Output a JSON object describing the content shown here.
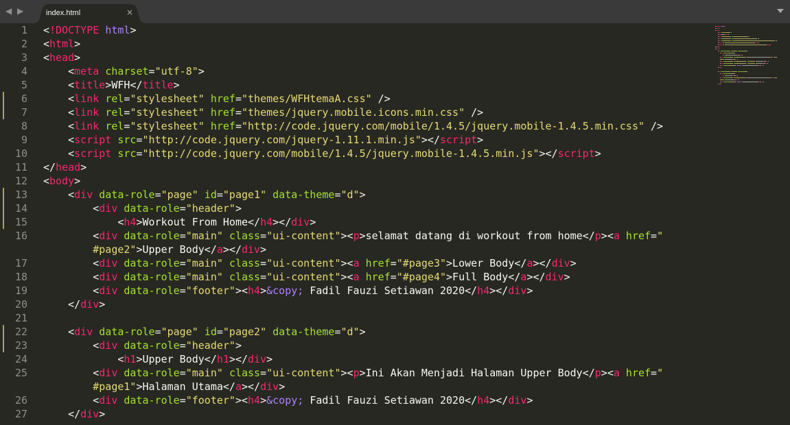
{
  "tab": {
    "title": "index.html",
    "close_label": "×"
  },
  "nav": {
    "arrows": "◀ ▶"
  },
  "lines": [
    {
      "n": "1",
      "parts": [
        [
          "p",
          "<"
        ],
        [
          "t",
          "!DOCTYPE"
        ],
        [
          "p",
          " "
        ],
        [
          "e",
          "html"
        ],
        [
          "p",
          ">"
        ]
      ]
    },
    {
      "n": "2",
      "parts": [
        [
          "p",
          "<"
        ],
        [
          "t",
          "html"
        ],
        [
          "p",
          ">"
        ]
      ]
    },
    {
      "n": "3",
      "parts": [
        [
          "p",
          "<"
        ],
        [
          "t",
          "head"
        ],
        [
          "p",
          ">"
        ]
      ]
    },
    {
      "n": "4",
      "parts": [
        [
          "p",
          "    <"
        ],
        [
          "t",
          "meta"
        ],
        [
          "p",
          " "
        ],
        [
          "a",
          "charset"
        ],
        [
          "p",
          "="
        ],
        [
          "s",
          "\"utf-8\""
        ],
        [
          "p",
          ">"
        ]
      ]
    },
    {
      "n": "5",
      "parts": [
        [
          "p",
          "    <"
        ],
        [
          "t",
          "title"
        ],
        [
          "p",
          ">WFH</"
        ],
        [
          "t",
          "title"
        ],
        [
          "p",
          ">"
        ]
      ]
    },
    {
      "n": "6",
      "parts": [
        [
          "p",
          "    <"
        ],
        [
          "t",
          "link"
        ],
        [
          "p",
          " "
        ],
        [
          "a",
          "rel"
        ],
        [
          "p",
          "="
        ],
        [
          "s",
          "\"stylesheet\""
        ],
        [
          "p",
          " "
        ],
        [
          "a",
          "href"
        ],
        [
          "p",
          "="
        ],
        [
          "s",
          "\"themes/WFHtemaA.css\""
        ],
        [
          "p",
          " />"
        ]
      ]
    },
    {
      "n": "7",
      "parts": [
        [
          "p",
          "    <"
        ],
        [
          "t",
          "link"
        ],
        [
          "p",
          " "
        ],
        [
          "a",
          "rel"
        ],
        [
          "p",
          "="
        ],
        [
          "s",
          "\"stylesheet\""
        ],
        [
          "p",
          " "
        ],
        [
          "a",
          "href"
        ],
        [
          "p",
          "="
        ],
        [
          "s",
          "\"themes/jquery.mobile.icons.min.css\""
        ],
        [
          "p",
          " />"
        ]
      ]
    },
    {
      "n": "8",
      "parts": [
        [
          "p",
          "    <"
        ],
        [
          "t",
          "link"
        ],
        [
          "p",
          " "
        ],
        [
          "a",
          "rel"
        ],
        [
          "p",
          "="
        ],
        [
          "s",
          "\"stylesheet\""
        ],
        [
          "p",
          " "
        ],
        [
          "a",
          "href"
        ],
        [
          "p",
          "="
        ],
        [
          "s",
          "\"http://code.jquery.com/mobile/1.4.5/jquery.mobile-1.4.5.min.css\""
        ],
        [
          "p",
          " />"
        ]
      ]
    },
    {
      "n": "9",
      "parts": [
        [
          "p",
          "    <"
        ],
        [
          "t",
          "script"
        ],
        [
          "p",
          " "
        ],
        [
          "a",
          "src"
        ],
        [
          "p",
          "="
        ],
        [
          "s",
          "\"http://code.jquery.com/jquery-1.11.1.min.js\""
        ],
        [
          "p",
          "></"
        ],
        [
          "t",
          "script"
        ],
        [
          "p",
          ">"
        ]
      ]
    },
    {
      "n": "10",
      "parts": [
        [
          "p",
          "    <"
        ],
        [
          "t",
          "script"
        ],
        [
          "p",
          " "
        ],
        [
          "a",
          "src"
        ],
        [
          "p",
          "="
        ],
        [
          "s",
          "\"http://code.jquery.com/mobile/1.4.5/jquery.mobile-1.4.5.min.js\""
        ],
        [
          "p",
          "></"
        ],
        [
          "t",
          "script"
        ],
        [
          "p",
          ">"
        ]
      ]
    },
    {
      "n": "11",
      "parts": [
        [
          "p",
          "</"
        ],
        [
          "t",
          "head"
        ],
        [
          "p",
          ">"
        ]
      ]
    },
    {
      "n": "12",
      "parts": [
        [
          "p",
          "<"
        ],
        [
          "t",
          "body"
        ],
        [
          "p",
          ">"
        ]
      ]
    },
    {
      "n": "13",
      "parts": [
        [
          "p",
          "    <"
        ],
        [
          "t",
          "div"
        ],
        [
          "p",
          " "
        ],
        [
          "a",
          "data-role"
        ],
        [
          "p",
          "="
        ],
        [
          "s",
          "\"page\""
        ],
        [
          "p",
          " "
        ],
        [
          "a",
          "id"
        ],
        [
          "p",
          "="
        ],
        [
          "s",
          "\"page1\""
        ],
        [
          "p",
          " "
        ],
        [
          "a",
          "data-theme"
        ],
        [
          "p",
          "="
        ],
        [
          "s",
          "\"d\""
        ],
        [
          "p",
          ">"
        ]
      ]
    },
    {
      "n": "14",
      "parts": [
        [
          "p",
          "        <"
        ],
        [
          "t",
          "div"
        ],
        [
          "p",
          " "
        ],
        [
          "a",
          "data-role"
        ],
        [
          "p",
          "="
        ],
        [
          "s",
          "\"header\""
        ],
        [
          "p",
          ">"
        ]
      ]
    },
    {
      "n": "15",
      "parts": [
        [
          "p",
          "            <"
        ],
        [
          "t",
          "h4"
        ],
        [
          "p",
          ">Workout From Home</"
        ],
        [
          "t",
          "h4"
        ],
        [
          "p",
          "></"
        ],
        [
          "t",
          "div"
        ],
        [
          "p",
          ">"
        ]
      ]
    },
    {
      "n": "16",
      "parts": [
        [
          "p",
          "        <"
        ],
        [
          "t",
          "div"
        ],
        [
          "p",
          " "
        ],
        [
          "a",
          "data-role"
        ],
        [
          "p",
          "="
        ],
        [
          "s",
          "\"main\""
        ],
        [
          "p",
          " "
        ],
        [
          "a",
          "class"
        ],
        [
          "p",
          "="
        ],
        [
          "s",
          "\"ui-content\""
        ],
        [
          "p",
          "><"
        ],
        [
          "t",
          "p"
        ],
        [
          "p",
          ">selamat datang di workout from home</"
        ],
        [
          "t",
          "p"
        ],
        [
          "p",
          "><"
        ],
        [
          "t",
          "a"
        ],
        [
          "p",
          " "
        ],
        [
          "a",
          "href"
        ],
        [
          "p",
          "="
        ],
        [
          "s",
          "\""
        ]
      ]
    },
    {
      "n": "",
      "parts": [
        [
          "s",
          "        #page2\""
        ],
        [
          "p",
          ">Upper Body</"
        ],
        [
          "t",
          "a"
        ],
        [
          "p",
          "></"
        ],
        [
          "t",
          "div"
        ],
        [
          "p",
          ">"
        ]
      ]
    },
    {
      "n": "17",
      "parts": [
        [
          "p",
          "        <"
        ],
        [
          "t",
          "div"
        ],
        [
          "p",
          " "
        ],
        [
          "a",
          "data-role"
        ],
        [
          "p",
          "="
        ],
        [
          "s",
          "\"main\""
        ],
        [
          "p",
          " "
        ],
        [
          "a",
          "class"
        ],
        [
          "p",
          "="
        ],
        [
          "s",
          "\"ui-content\""
        ],
        [
          "p",
          "><"
        ],
        [
          "t",
          "a"
        ],
        [
          "p",
          " "
        ],
        [
          "a",
          "href"
        ],
        [
          "p",
          "="
        ],
        [
          "s",
          "\"#page3\""
        ],
        [
          "p",
          ">Lower Body</"
        ],
        [
          "t",
          "a"
        ],
        [
          "p",
          "></"
        ],
        [
          "t",
          "div"
        ],
        [
          "p",
          ">"
        ]
      ]
    },
    {
      "n": "18",
      "parts": [
        [
          "p",
          "        <"
        ],
        [
          "t",
          "div"
        ],
        [
          "p",
          " "
        ],
        [
          "a",
          "data-role"
        ],
        [
          "p",
          "="
        ],
        [
          "s",
          "\"main\""
        ],
        [
          "p",
          " "
        ],
        [
          "a",
          "class"
        ],
        [
          "p",
          "="
        ],
        [
          "s",
          "\"ui-content\""
        ],
        [
          "p",
          "><"
        ],
        [
          "t",
          "a"
        ],
        [
          "p",
          " "
        ],
        [
          "a",
          "href"
        ],
        [
          "p",
          "="
        ],
        [
          "s",
          "\"#page4\""
        ],
        [
          "p",
          ">Full Body</"
        ],
        [
          "t",
          "a"
        ],
        [
          "p",
          "></"
        ],
        [
          "t",
          "div"
        ],
        [
          "p",
          ">"
        ]
      ]
    },
    {
      "n": "19",
      "parts": [
        [
          "p",
          "        <"
        ],
        [
          "t",
          "div"
        ],
        [
          "p",
          " "
        ],
        [
          "a",
          "data-role"
        ],
        [
          "p",
          "="
        ],
        [
          "s",
          "\"footer\""
        ],
        [
          "p",
          "><"
        ],
        [
          "t",
          "h4"
        ],
        [
          "p",
          ">"
        ],
        [
          "e",
          "&copy;"
        ],
        [
          "p",
          " Fadil Fauzi Setiawan 2020</"
        ],
        [
          "t",
          "h4"
        ],
        [
          "p",
          "></"
        ],
        [
          "t",
          "div"
        ],
        [
          "p",
          ">"
        ]
      ]
    },
    {
      "n": "20",
      "parts": [
        [
          "p",
          "    </"
        ],
        [
          "t",
          "div"
        ],
        [
          "p",
          ">"
        ]
      ]
    },
    {
      "n": "21",
      "parts": []
    },
    {
      "n": "22",
      "parts": [
        [
          "p",
          "    <"
        ],
        [
          "t",
          "div"
        ],
        [
          "p",
          " "
        ],
        [
          "a",
          "data-role"
        ],
        [
          "p",
          "="
        ],
        [
          "s",
          "\"page\""
        ],
        [
          "p",
          " "
        ],
        [
          "a",
          "id"
        ],
        [
          "p",
          "="
        ],
        [
          "s",
          "\"page2\""
        ],
        [
          "p",
          " "
        ],
        [
          "a",
          "data-theme"
        ],
        [
          "p",
          "="
        ],
        [
          "s",
          "\"d\""
        ],
        [
          "p",
          ">"
        ]
      ]
    },
    {
      "n": "23",
      "parts": [
        [
          "p",
          "        <"
        ],
        [
          "t",
          "div"
        ],
        [
          "p",
          " "
        ],
        [
          "a",
          "data-role"
        ],
        [
          "p",
          "="
        ],
        [
          "s",
          "\"header\""
        ],
        [
          "p",
          ">"
        ]
      ]
    },
    {
      "n": "24",
      "parts": [
        [
          "p",
          "            <"
        ],
        [
          "t",
          "h1"
        ],
        [
          "p",
          ">Upper Body</"
        ],
        [
          "t",
          "h1"
        ],
        [
          "p",
          "></"
        ],
        [
          "t",
          "div"
        ],
        [
          "p",
          ">"
        ]
      ]
    },
    {
      "n": "25",
      "parts": [
        [
          "p",
          "        <"
        ],
        [
          "t",
          "div"
        ],
        [
          "p",
          " "
        ],
        [
          "a",
          "data-role"
        ],
        [
          "p",
          "="
        ],
        [
          "s",
          "\"main\""
        ],
        [
          "p",
          " "
        ],
        [
          "a",
          "class"
        ],
        [
          "p",
          "="
        ],
        [
          "s",
          "\"ui-content\""
        ],
        [
          "p",
          "><"
        ],
        [
          "t",
          "p"
        ],
        [
          "p",
          ">Ini Akan Menjadi Halaman Upper Body</"
        ],
        [
          "t",
          "p"
        ],
        [
          "p",
          "><"
        ],
        [
          "t",
          "a"
        ],
        [
          "p",
          " "
        ],
        [
          "a",
          "href"
        ],
        [
          "p",
          "="
        ],
        [
          "s",
          "\""
        ]
      ]
    },
    {
      "n": "",
      "parts": [
        [
          "s",
          "        #page1\""
        ],
        [
          "p",
          ">Halaman Utama</"
        ],
        [
          "t",
          "a"
        ],
        [
          "p",
          "></"
        ],
        [
          "t",
          "div"
        ],
        [
          "p",
          ">"
        ]
      ]
    },
    {
      "n": "26",
      "parts": [
        [
          "p",
          "        <"
        ],
        [
          "t",
          "div"
        ],
        [
          "p",
          " "
        ],
        [
          "a",
          "data-role"
        ],
        [
          "p",
          "="
        ],
        [
          "s",
          "\"footer\""
        ],
        [
          "p",
          "><"
        ],
        [
          "t",
          "h4"
        ],
        [
          "p",
          ">"
        ],
        [
          "e",
          "&copy;"
        ],
        [
          "p",
          " Fadil Fauzi Setiawan 2020</"
        ],
        [
          "t",
          "h4"
        ],
        [
          "p",
          "></"
        ],
        [
          "t",
          "div"
        ],
        [
          "p",
          ">"
        ]
      ]
    },
    {
      "n": "27",
      "parts": [
        [
          "p",
          "    </"
        ],
        [
          "t",
          "div"
        ],
        [
          "p",
          ">"
        ]
      ]
    }
  ],
  "colors": {
    "background": "#272822",
    "tab_bar": "#3a3a3a",
    "tag": "#f92672",
    "attribute": "#a6e22e",
    "string": "#e6db74",
    "entity": "#ae81ff",
    "text": "#f8f8f2",
    "line_number": "#8f908a",
    "modified_marker": "#a6a65a"
  }
}
